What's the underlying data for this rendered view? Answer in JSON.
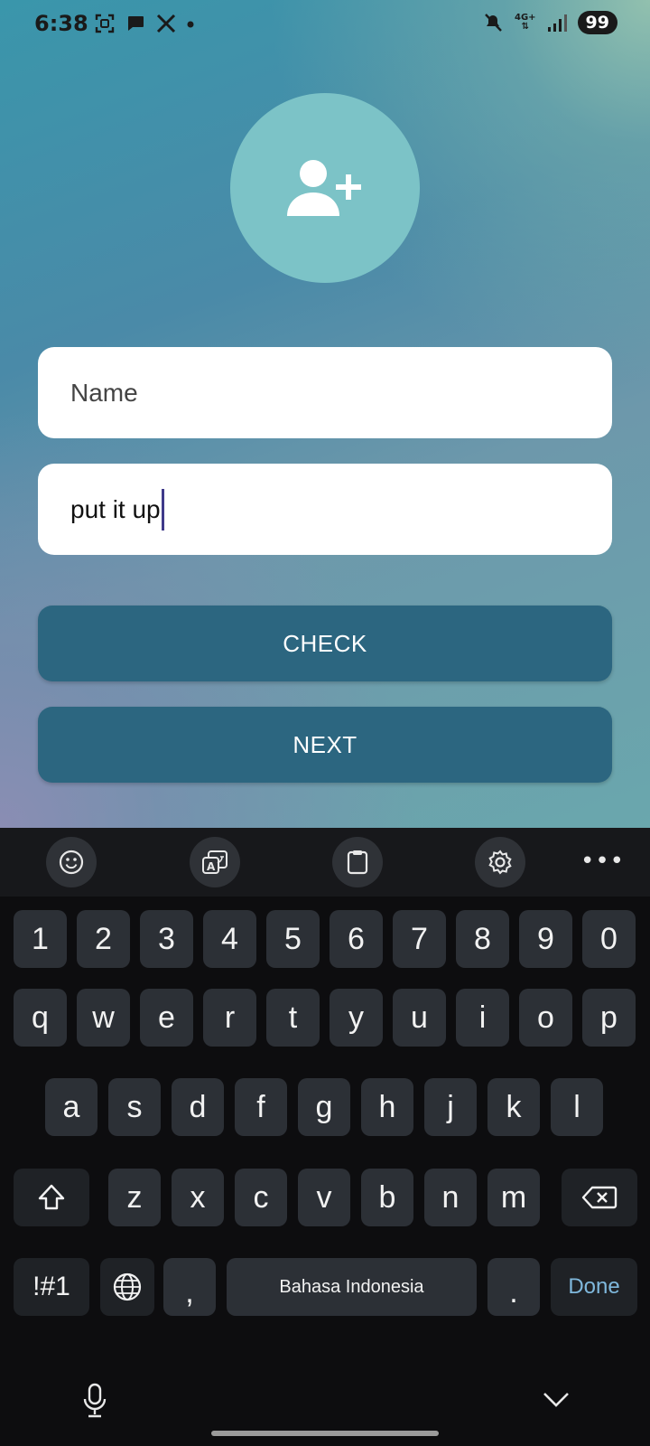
{
  "status_bar": {
    "time": "6:38",
    "network": "4G+",
    "battery": "99",
    "icons": [
      "screenshot-icon",
      "chat-icon",
      "x-logo-icon",
      "dot-icon",
      "mute-icon",
      "network-4g-icon",
      "signal-icon",
      "battery-icon"
    ]
  },
  "avatar": {
    "icon": "add-user-icon",
    "color": "#7cc3c7"
  },
  "form": {
    "name_placeholder": "Name",
    "input_value": "put it up",
    "check_label": "CHECK",
    "next_label": "NEXT",
    "button_color": "#2c6680"
  },
  "keyboard": {
    "toolbar": [
      "emoji-icon",
      "translate-icon",
      "clipboard-icon",
      "settings-icon",
      "more-icon"
    ],
    "more_label": "•••",
    "row_numbers": [
      "1",
      "2",
      "3",
      "4",
      "5",
      "6",
      "7",
      "8",
      "9",
      "0"
    ],
    "row1": [
      "q",
      "w",
      "e",
      "r",
      "t",
      "y",
      "u",
      "i",
      "o",
      "p"
    ],
    "row2": [
      "a",
      "s",
      "d",
      "f",
      "g",
      "h",
      "j",
      "k",
      "l"
    ],
    "row3": [
      "z",
      "x",
      "c",
      "v",
      "b",
      "n",
      "m"
    ],
    "symbols_label": "!#1",
    "comma_label": ",",
    "space_label": "Bahasa Indonesia",
    "period_label": ".",
    "done_label": "Done",
    "done_color": "#7fb8dc"
  },
  "nav": {
    "icons": [
      "microphone-icon",
      "keyboard-hide-chevron-icon"
    ]
  }
}
